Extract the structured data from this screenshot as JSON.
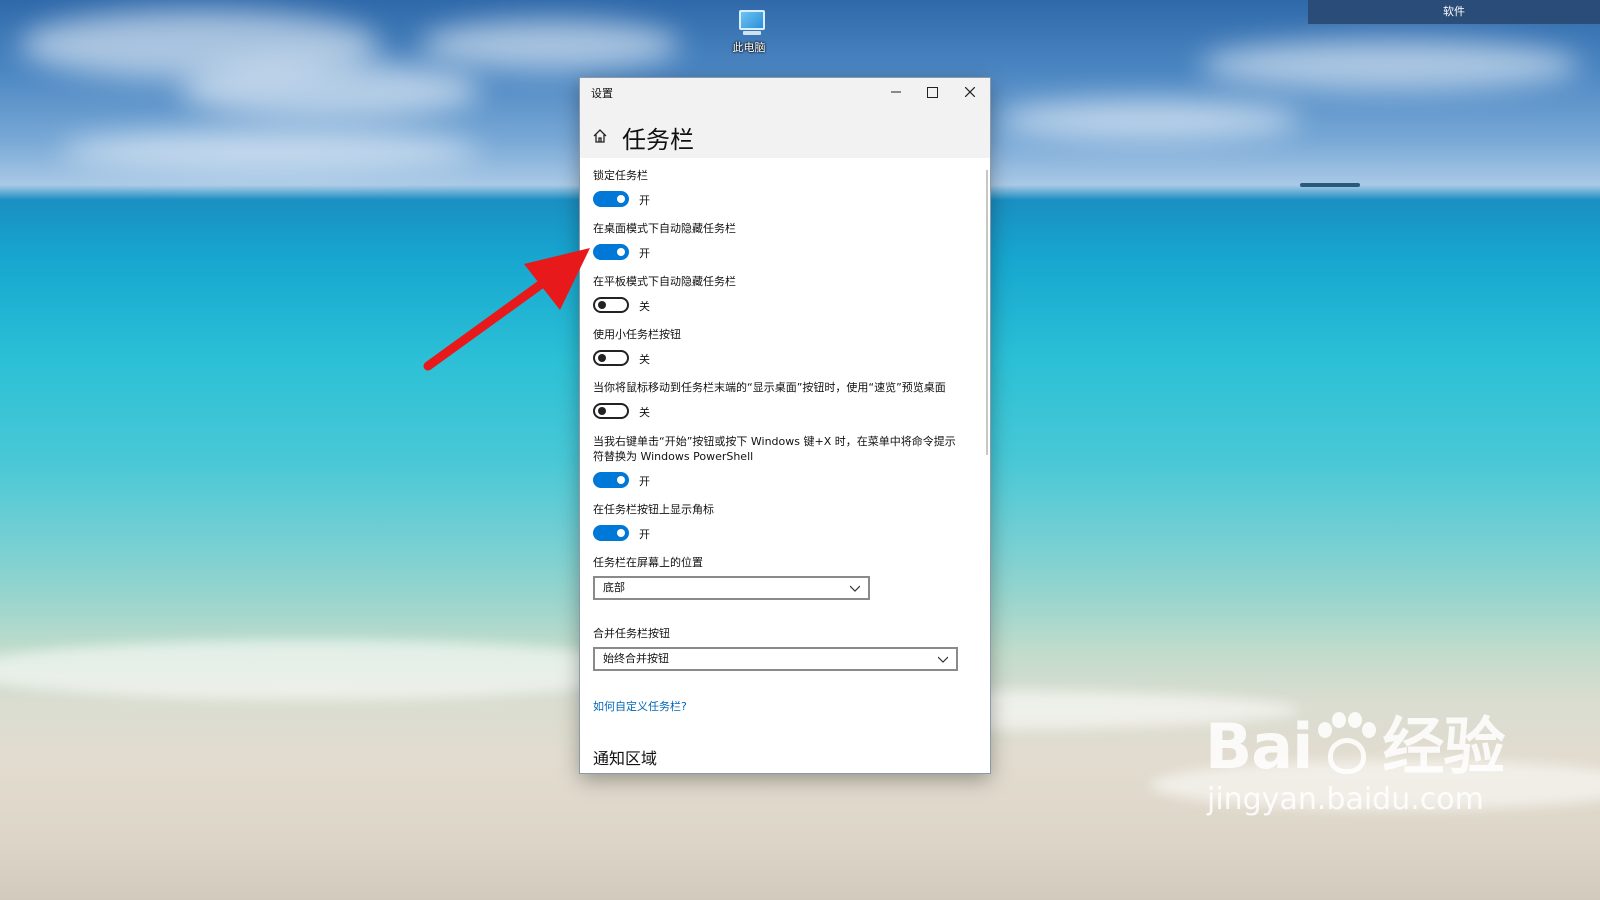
{
  "desktop": {
    "icon_label": "此电脑",
    "corner_label": "软件"
  },
  "window": {
    "title": "设置",
    "page_title": "任务栏"
  },
  "settings": [
    {
      "label": "锁定任务栏",
      "state": "开",
      "on": true
    },
    {
      "label": "在桌面模式下自动隐藏任务栏",
      "state": "开",
      "on": true
    },
    {
      "label": "在平板模式下自动隐藏任务栏",
      "state": "关",
      "on": false
    },
    {
      "label": "使用小任务栏按钮",
      "state": "关",
      "on": false
    },
    {
      "label": "当你将鼠标移动到任务栏末端的“显示桌面”按钮时，使用“速览”预览桌面",
      "state": "关",
      "on": false
    },
    {
      "label": "当我右键单击“开始”按钮或按下 Windows 键+X 时，在菜单中将命令提示符替换为 Windows PowerShell",
      "state": "开",
      "on": true
    },
    {
      "label": "在任务栏按钮上显示角标",
      "state": "开",
      "on": true
    }
  ],
  "position": {
    "label": "任务栏在屏幕上的位置",
    "value": "底部"
  },
  "combine": {
    "label": "合并任务栏按钮",
    "value": "始终合并按钮"
  },
  "help_link": "如何自定义任务栏?",
  "notification_section": "通知区域",
  "watermark": {
    "brand_left": "Bai",
    "brand_right": "经验",
    "url": "jingyan.baidu.com"
  },
  "colors": {
    "accent": "#0078d7",
    "link": "#0067b8",
    "arrow": "#e8191a"
  }
}
